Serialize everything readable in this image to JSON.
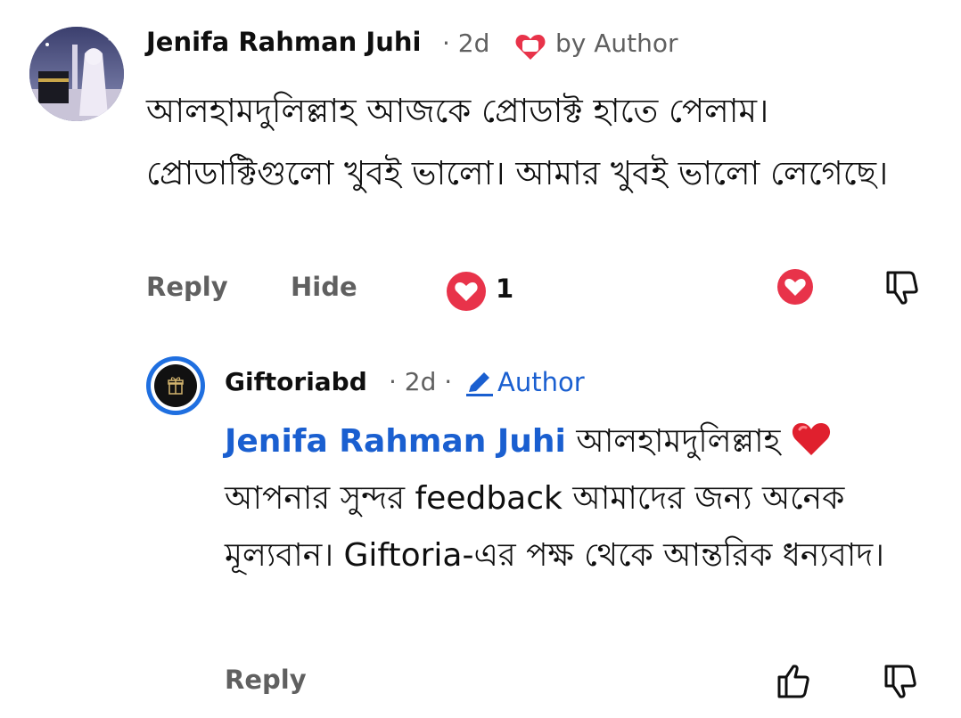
{
  "comment": {
    "author": "Jenifa Rahman Juhi",
    "time": "· 2d",
    "hearted_by": "by Author",
    "text": "আলহামদুলিল্লাহ আজকে প্রোডাক্ট হাতে পেলাম। প্রোডাক্টিগুলো খুবই ভালো। আমার খুবই ভালো লেগেছে।",
    "actions": {
      "reply_label": "Reply",
      "hide_label": "Hide",
      "heart_count": "1"
    }
  },
  "reply": {
    "author": "Giftoriabd",
    "time": "· 2d ·",
    "author_badge": "Author",
    "mention": "Jenifa Rahman Juhi",
    "text_part1": " আলহামদুলিল্লাহ ",
    "text_part2": " আপনার সুন্দর feedback আমাদের জন্য অনেক মূল্যবান। Giftoria-এর পক্ষ থেকে আন্তরিক ধন্যবাদ।",
    "actions": {
      "reply_label": "Reply"
    }
  },
  "colors": {
    "heart_red": "#e8334a",
    "link_blue": "#1a5fd0",
    "meta_gray": "#606060"
  },
  "icons": {
    "heart": "heart-icon",
    "dislike": "thumbs-down-icon",
    "like": "thumbs-up-icon",
    "pencil": "pencil-icon"
  }
}
